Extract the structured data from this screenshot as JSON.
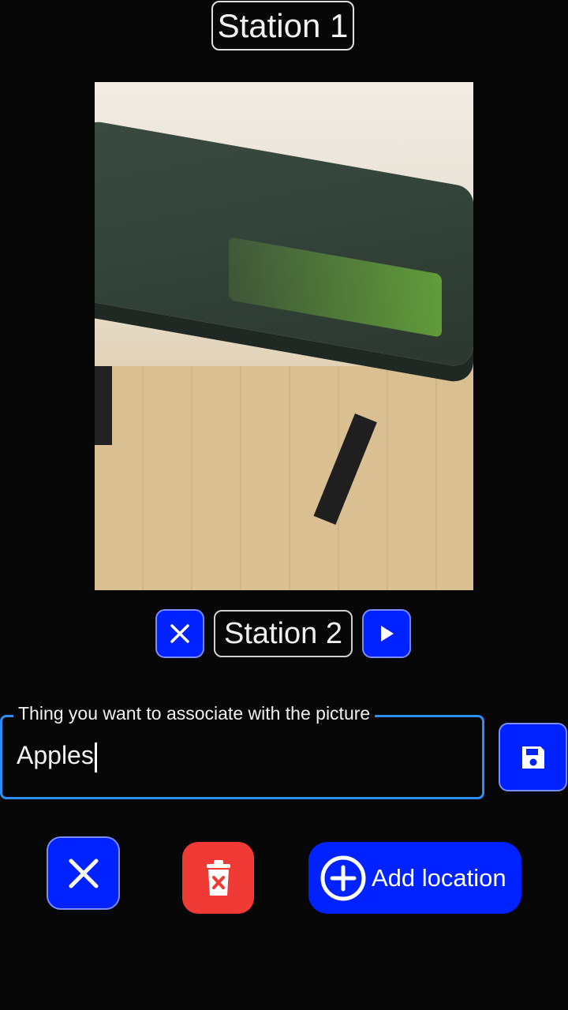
{
  "header": {
    "title": "Station 1"
  },
  "photo": {
    "alt_semantic": "photo-of-bench"
  },
  "navigator": {
    "current_label": "Station 2",
    "close_icon": "close-icon",
    "next_icon": "play-arrow-icon"
  },
  "association_field": {
    "label": "Thing you want to associate with the picture",
    "value": "Apples"
  },
  "actions": {
    "save_icon": "save-icon",
    "cancel_icon": "close-icon",
    "delete_icon": "trash-icon",
    "add_location_label": "Add location",
    "add_location_icon": "plus-circle-icon"
  },
  "colors": {
    "accent_blue": "#0022ff",
    "danger_red": "#f03a36",
    "field_border": "#2e8df3",
    "background": "#070707"
  }
}
